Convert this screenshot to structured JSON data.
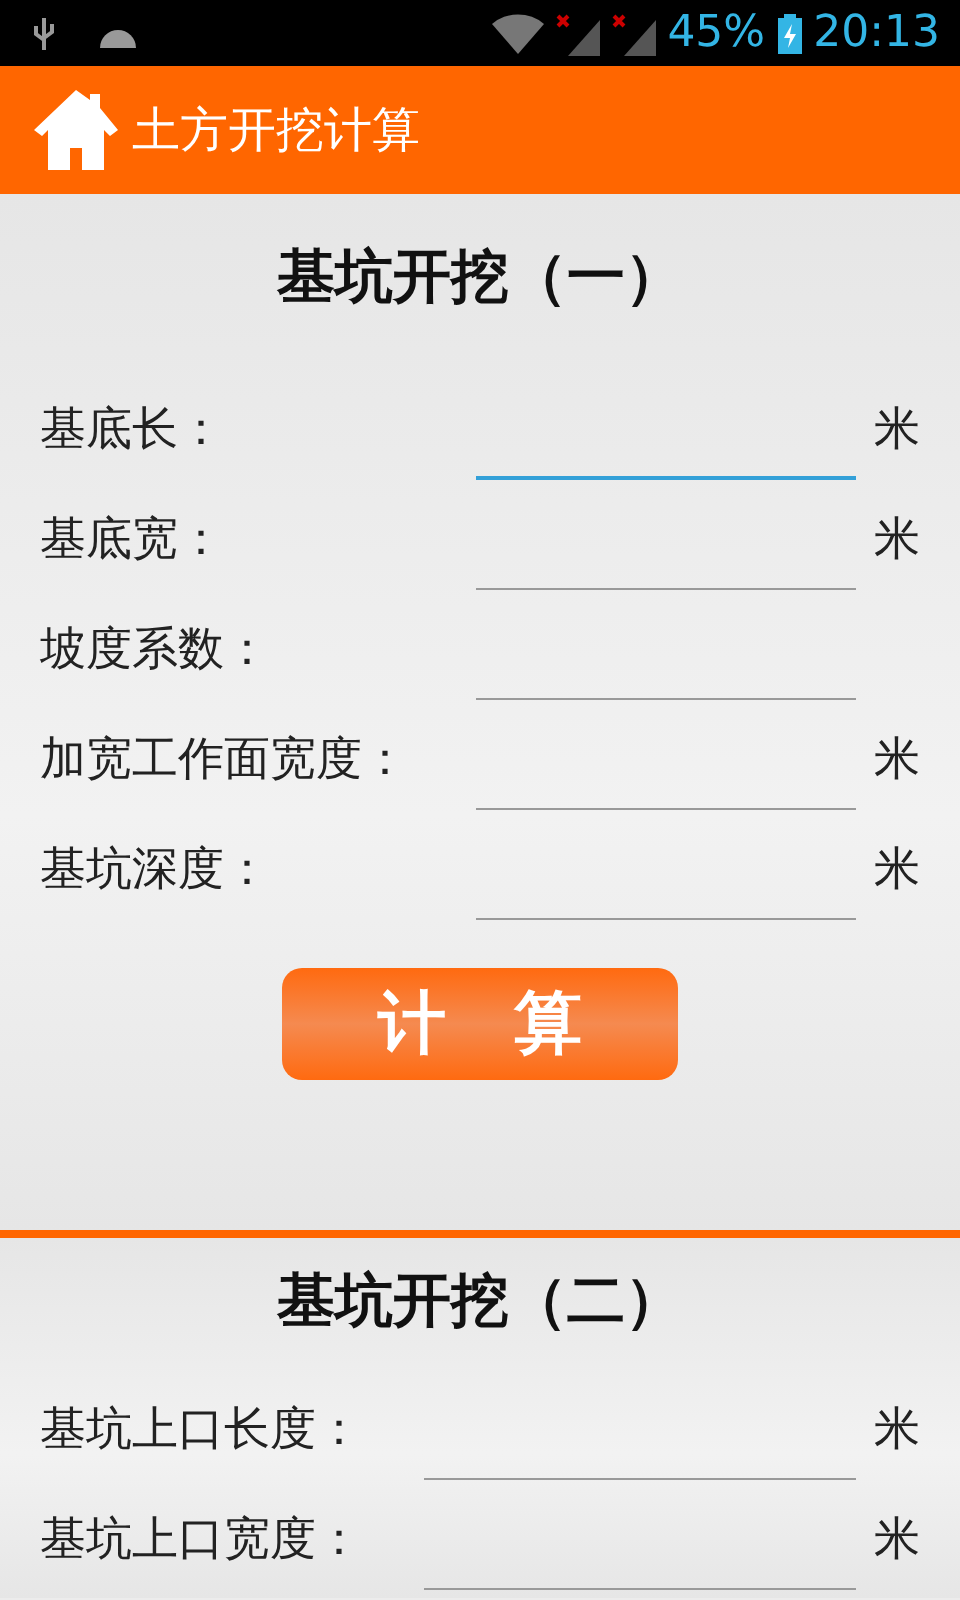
{
  "status_bar": {
    "battery": "45%",
    "time": "20:13"
  },
  "app_bar": {
    "title": "土方开挖计算"
  },
  "sections": [
    {
      "title": "基坑开挖（一）",
      "rows": [
        {
          "label": "基底长：",
          "unit": "米",
          "focused": true
        },
        {
          "label": "基底宽：",
          "unit": "米",
          "focused": false
        },
        {
          "label": "坡度系数：",
          "focused": false
        },
        {
          "label": "加宽工作面宽度：",
          "unit": "米",
          "focused": false
        },
        {
          "label": "基坑深度：",
          "unit": "米",
          "focused": false
        }
      ],
      "button": "计　算"
    },
    {
      "title": "基坑开挖（二）",
      "rows": [
        {
          "label": "基坑上口长度：",
          "unit": "米",
          "focused": false
        },
        {
          "label": "基坑上口宽度：",
          "unit": "米",
          "focused": false
        }
      ]
    }
  ]
}
